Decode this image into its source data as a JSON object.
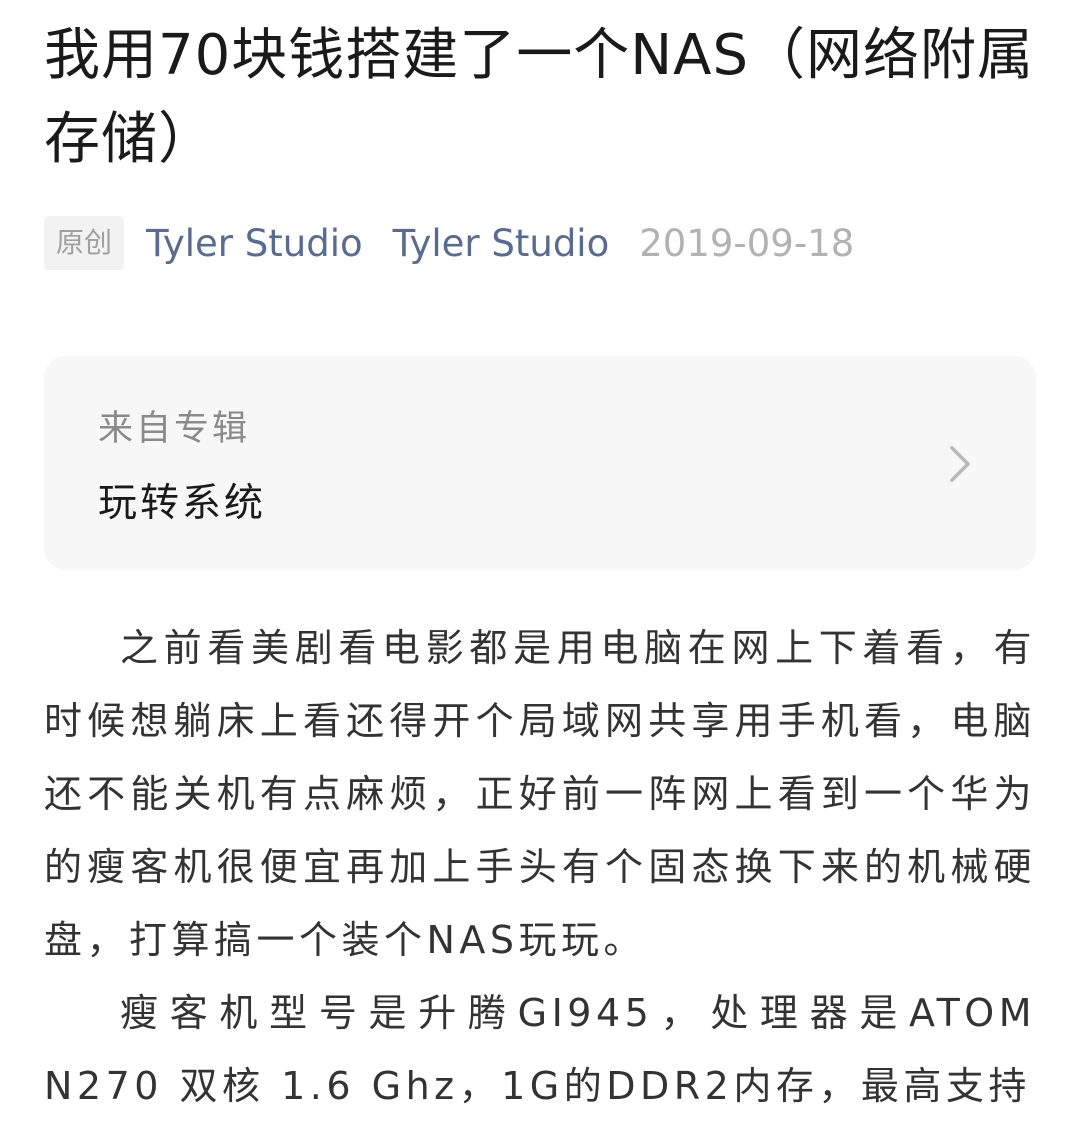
{
  "article": {
    "title": "我用70块钱搭建了一个NAS（网络附属存储）",
    "original_badge": "原创",
    "author": "Tyler Studio",
    "account_name": "Tyler Studio",
    "publish_date": "2019-09-18",
    "paragraphs": [
      "之前看美剧看电影都是用电脑在网上下着看，有时候想躺床上看还得开个局域网共享用手机看，电脑还不能关机有点麻烦，正好前一阵网上看到一个华为的瘦客机很便宜再加上手头有个固态换下来的机械硬盘，打算搞一个装个NAS玩玩。",
      "瘦客机型号是升腾GI945，处理器是ATOM N270 双核 1.6 Ghz，1G的DDR2内存，最高支持"
    ]
  },
  "album": {
    "from_label": "来自专辑",
    "name": "玩转系统",
    "icon": "chevron-right-icon"
  },
  "colors": {
    "link": "#576b95",
    "meta_gray": "#b2b2b2",
    "card_bg": "#f7f7f7",
    "text": "#333333"
  }
}
